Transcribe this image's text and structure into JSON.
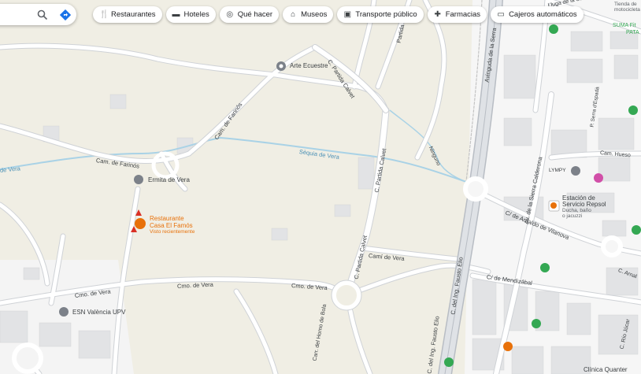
{
  "search": {
    "search_icon": "search-icon",
    "directions_icon": "directions-icon"
  },
  "chips": [
    {
      "label": "Restaurantes",
      "icon": "fork-knife-icon"
    },
    {
      "label": "Hoteles",
      "icon": "bed-icon"
    },
    {
      "label": "Qué hacer",
      "icon": "camera-icon"
    },
    {
      "label": "Museos",
      "icon": "museum-icon"
    },
    {
      "label": "Transporte público",
      "icon": "bus-icon"
    },
    {
      "label": "Farmacias",
      "icon": "pharmacy-icon"
    },
    {
      "label": "Cajeros automáticos",
      "icon": "atm-icon"
    }
  ],
  "places": {
    "arte_ecuestre": "Arte Ecuestre",
    "ermita": "Ermita de Vera",
    "restaurant_name1": "Restaurante",
    "restaurant_name2": "Casa El Famós",
    "restaurant_sub": "Visto recientemente",
    "esn": "ESN València UPV",
    "lympy": "LYMPY",
    "repsol1": "Estación de",
    "repsol2": "Servicio Repsol",
    "repsol3": "Ducha, baño",
    "repsol4": "o jacuzzi",
    "clinica": "Clínica Quanter",
    "suma1": "SUMA Fit",
    "suma2": "PATA",
    "tienda1": "Tienda de",
    "tienda2": "motocicleta"
  },
  "roads": {
    "c_partida_calvet_top": "C. Partida Calvet",
    "c_partida_calvet_mid": "C. Partida Calvet",
    "c_partida_calvet_low": "C. Partida Calvet",
    "partida": "Partida",
    "cam_farinos_1": "Cam. de Farinós",
    "cam_farinos_2": "Cam. de Farinós",
    "sequia": "Sèquia de Vera",
    "vera_left": "de Vera",
    "ninguno": "Ninguno",
    "av_sierra_top": "Avinguda de la Serra",
    "av_sierra_right": "Av. de la Sierra Calderona",
    "cam_huevo": "Cam. Hueso",
    "cam_espada": "P. Serra d'Espadà",
    "arnaldo": "C/ de Arnaldo de Vilanova",
    "fausto_elio_1": "C. del Ing. Fausto Elio",
    "fausto_elio_2": "C. del Ing. Fausto Elio",
    "mendizabal": "C/ de Mendizábal",
    "cami_vera": "Camí de Vera",
    "cmo_vera_1": "Cmo. de Vera",
    "cmo_vera_2": "Cmo. de Vera",
    "carr_horno": "Carr. del Horno de Bola",
    "lluga_serra": "Lluga de la Serra d'Irta",
    "arnal_right": "C. Arnal",
    "rio_jucar": "C. Río Júcar"
  },
  "colors": {
    "map_bg": "#f0eee4",
    "road": "#ffffff",
    "road_edge": "#c9ccd0",
    "building": "#e4e4e2",
    "water": "#a9d2e6",
    "green_poi": "#34a853",
    "orange_poi": "#e8710a",
    "pink_poi": "#d14fa8"
  }
}
